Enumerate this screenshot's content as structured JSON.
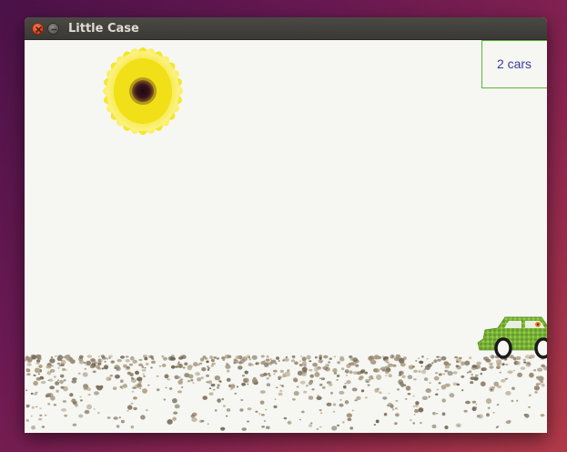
{
  "window": {
    "title": "Little Case",
    "close_icon": "close-icon",
    "minimize_icon": "minimize-icon"
  },
  "scene": {
    "sun_icon": "sunflower-icon",
    "car_icon": "car-icon",
    "ground": "pebble-ground",
    "car_count_label": "2 cars"
  },
  "colors": {
    "background": "#f6f7f2",
    "counter_border": "#5ab53a",
    "counter_text": "#3a3a9a",
    "titlebar": "#3f3e3a"
  }
}
